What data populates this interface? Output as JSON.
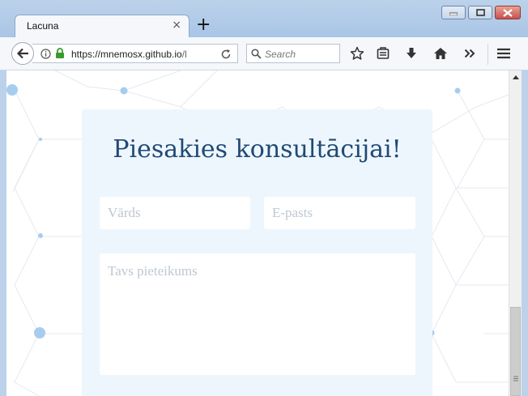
{
  "window": {
    "tab_title": "Lacuna",
    "tab_close": "×",
    "new_tab": "+"
  },
  "navbar": {
    "url_host": "https://mnemosx.github.io",
    "url_path": "/l",
    "search_placeholder": "Search"
  },
  "icons": [
    "back-arrow-icon",
    "info-icon",
    "lock-icon",
    "reload-icon",
    "search-icon",
    "bookmark-star-icon",
    "reading-list-icon",
    "download-icon",
    "home-icon",
    "overflow-chevron-icon",
    "hamburger-menu-icon"
  ],
  "colors": {
    "title": "#214a75",
    "card_bg": "#eef6fd",
    "chrome": "#bcd2ea",
    "dot": "#a7cdee"
  },
  "page": {
    "title": "Piesakies konsultācijai!",
    "name_placeholder": "Vārds",
    "email_placeholder": "E-pasts",
    "message_placeholder": "Tavs pieteikums"
  }
}
